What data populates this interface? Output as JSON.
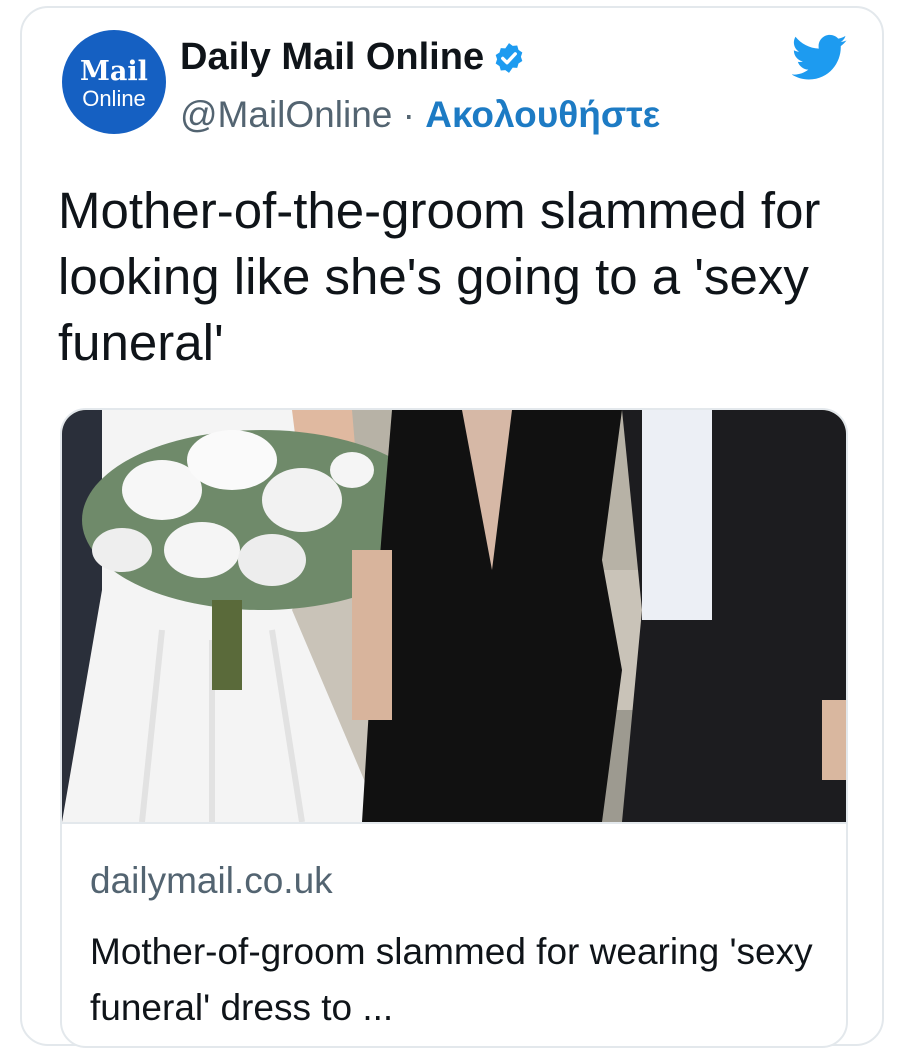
{
  "account": {
    "avatar_line1": "Mail",
    "avatar_line2": "Online",
    "display_name": "Daily Mail Online",
    "handle": "@MailOnline",
    "separator": " · ",
    "follow_label": "Ακολουθήστε",
    "verified_icon": "verified-badge-icon",
    "twitter_icon": "twitter-bird-icon"
  },
  "tweet": {
    "text": "Mother-of-the-groom slammed for looking like she's going to a 'sexy funeral'"
  },
  "link_card": {
    "domain": "dailymail.co.uk",
    "title": "Mother-of-groom slammed for wearing 'sexy funeral' dress to ..."
  },
  "colors": {
    "brand_blue": "#1560c2",
    "follow_blue": "#1d7bc4",
    "twitter_blue": "#1d9bf0",
    "text": "#0f1419",
    "muted": "#536471"
  }
}
